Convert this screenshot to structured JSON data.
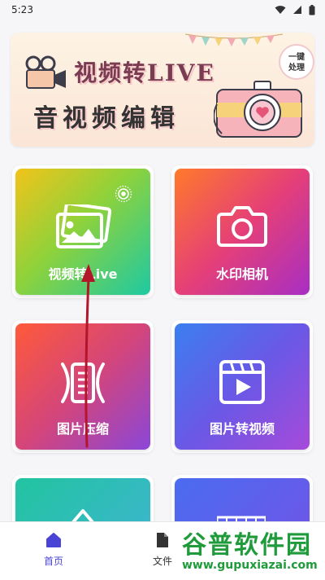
{
  "status": {
    "time": "5:23"
  },
  "banner": {
    "title1": "视频转LIVE",
    "title2": "音视频编辑",
    "badge_line1": "一键",
    "badge_line2": "处理"
  },
  "tiles": [
    {
      "label": "视频转Live",
      "icon": "image-icon"
    },
    {
      "label": "水印相机",
      "icon": "camera-icon"
    },
    {
      "label": "图片压缩",
      "icon": "compress-icon"
    },
    {
      "label": "图片转视频",
      "icon": "video-clip-icon"
    }
  ],
  "nav": {
    "home_label": "首页",
    "files_label": "文件",
    "active_color": "#4a44d6"
  },
  "watermark": {
    "top": "谷普软件园",
    "bottom": "www.gupuxiazai.com"
  }
}
